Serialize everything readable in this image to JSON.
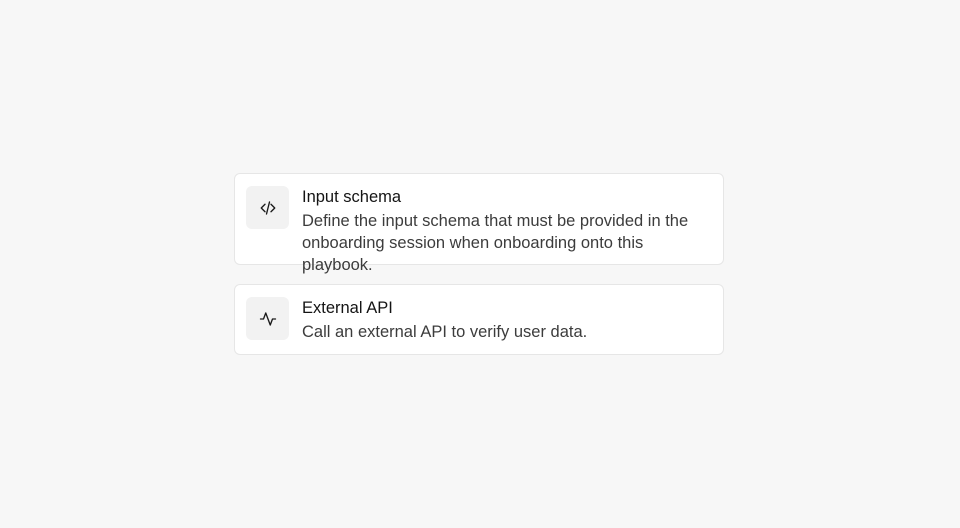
{
  "options": [
    {
      "icon": "code-icon",
      "title": "Input schema",
      "description": "Define the input schema that must be provided in the onboarding session when onboarding onto this playbook."
    },
    {
      "icon": "activity-icon",
      "title": "External API",
      "description": "Call an external API to verify user data."
    }
  ]
}
